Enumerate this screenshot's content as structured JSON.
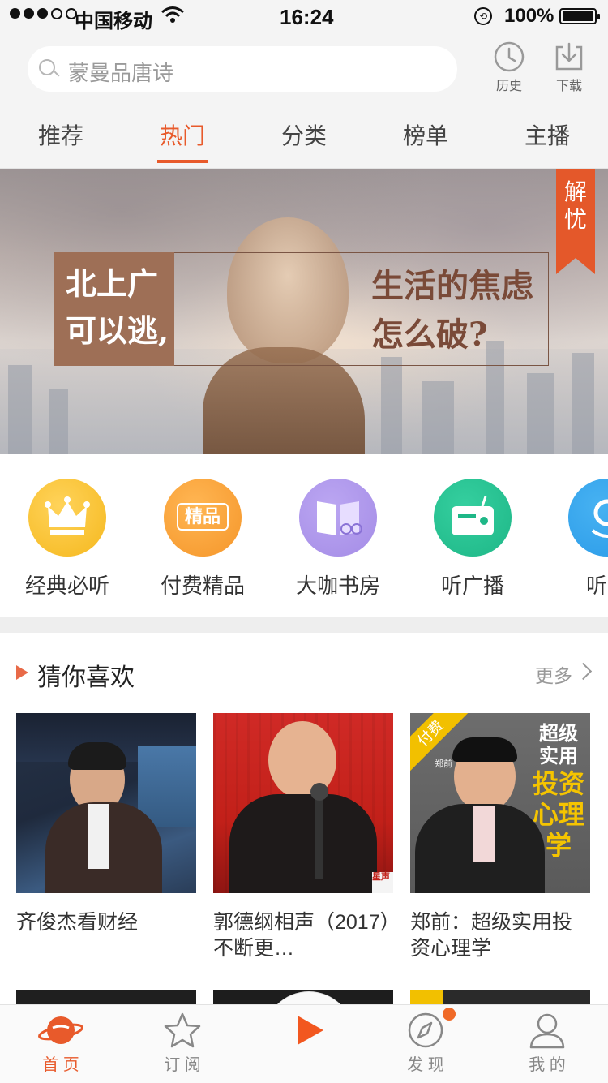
{
  "status_bar": {
    "carrier": "中国移动",
    "time": "16:24",
    "battery": "100%"
  },
  "search": {
    "placeholder": "蒙曼品唐诗"
  },
  "header_actions": {
    "history": "历史",
    "download": "下载"
  },
  "tabs": [
    {
      "label": "推荐"
    },
    {
      "label": "热门"
    },
    {
      "label": "分类"
    },
    {
      "label": "榜单"
    },
    {
      "label": "主播"
    }
  ],
  "banner": {
    "left_line1": "北上广",
    "left_line2": "可以逃,",
    "right_line1": "生活的焦虑",
    "right_line2": "怎么破?",
    "ribbon_line1": "解",
    "ribbon_line2": "忧"
  },
  "categories": [
    {
      "label": "经典必听",
      "icon": "crown-icon",
      "color": "#f5b81e",
      "inner": ""
    },
    {
      "label": "付费精品",
      "icon": "premium-icon",
      "color": "#f5962a",
      "inner": "精品"
    },
    {
      "label": "大咖书房",
      "icon": "book-icon",
      "color": "#a48ce6",
      "inner": ""
    },
    {
      "label": "听广播",
      "icon": "radio-icon",
      "color": "#1eb787",
      "inner": ""
    },
    {
      "label": "听广",
      "icon": "location-icon",
      "color": "#2b9be8",
      "inner": ""
    }
  ],
  "guess_section": {
    "title": "猜你喜欢",
    "more": "更多"
  },
  "cards": [
    {
      "title": "齐俊杰看财经"
    },
    {
      "title": "郭德纲相声（2017）不断更…",
      "watermark": "星声"
    },
    {
      "title": "郑前：超级实用投资心理学",
      "badge": "付费",
      "cover_line1": "超级",
      "cover_line2": "实用",
      "cover_line3": "投资",
      "cover_line4": "心理",
      "cover_line5": "学",
      "cover_name": "郑前"
    }
  ],
  "bottom_nav": [
    {
      "label": "首 页",
      "icon": "planet-icon"
    },
    {
      "label": "订 阅",
      "icon": "star-icon"
    },
    {
      "label": "发 现",
      "icon": "compass-icon"
    },
    {
      "label": "我 的",
      "icon": "user-icon"
    }
  ],
  "colors": {
    "accent": "#e85a2b",
    "header_bg": "#f4f4f4"
  }
}
